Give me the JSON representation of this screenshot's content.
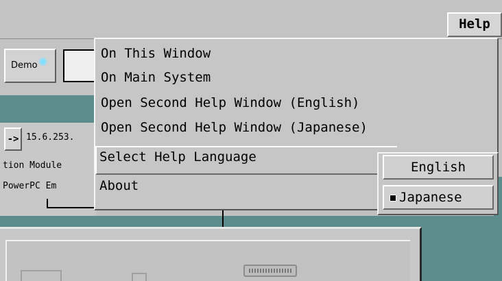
{
  "menubar": {
    "help_label": "Help"
  },
  "toolbar": {
    "demo_label": "Demo",
    "demo_icon": "starburst-icon"
  },
  "system_list": {
    "arrow_label": "->",
    "ip_address": "15.6.253.",
    "module_text": "tion Module",
    "emulator_text": "PowerPC Em"
  },
  "help_menu": {
    "items": [
      {
        "label": "On This Window"
      },
      {
        "label": "On Main System"
      },
      {
        "label": "Open Second Help Window (English)"
      },
      {
        "label": "Open Second Help Window (Japanese)"
      },
      {
        "label": "Select Help Language"
      },
      {
        "label": "About"
      }
    ]
  },
  "language_submenu": {
    "options": [
      {
        "label": "English",
        "selected": false
      },
      {
        "label": "Japanese",
        "selected": true
      }
    ]
  },
  "colors": {
    "desktop_teal": "#5d8c8c",
    "panel_gray": "#c6c6c6",
    "demo_star": "#7fe0ff"
  }
}
